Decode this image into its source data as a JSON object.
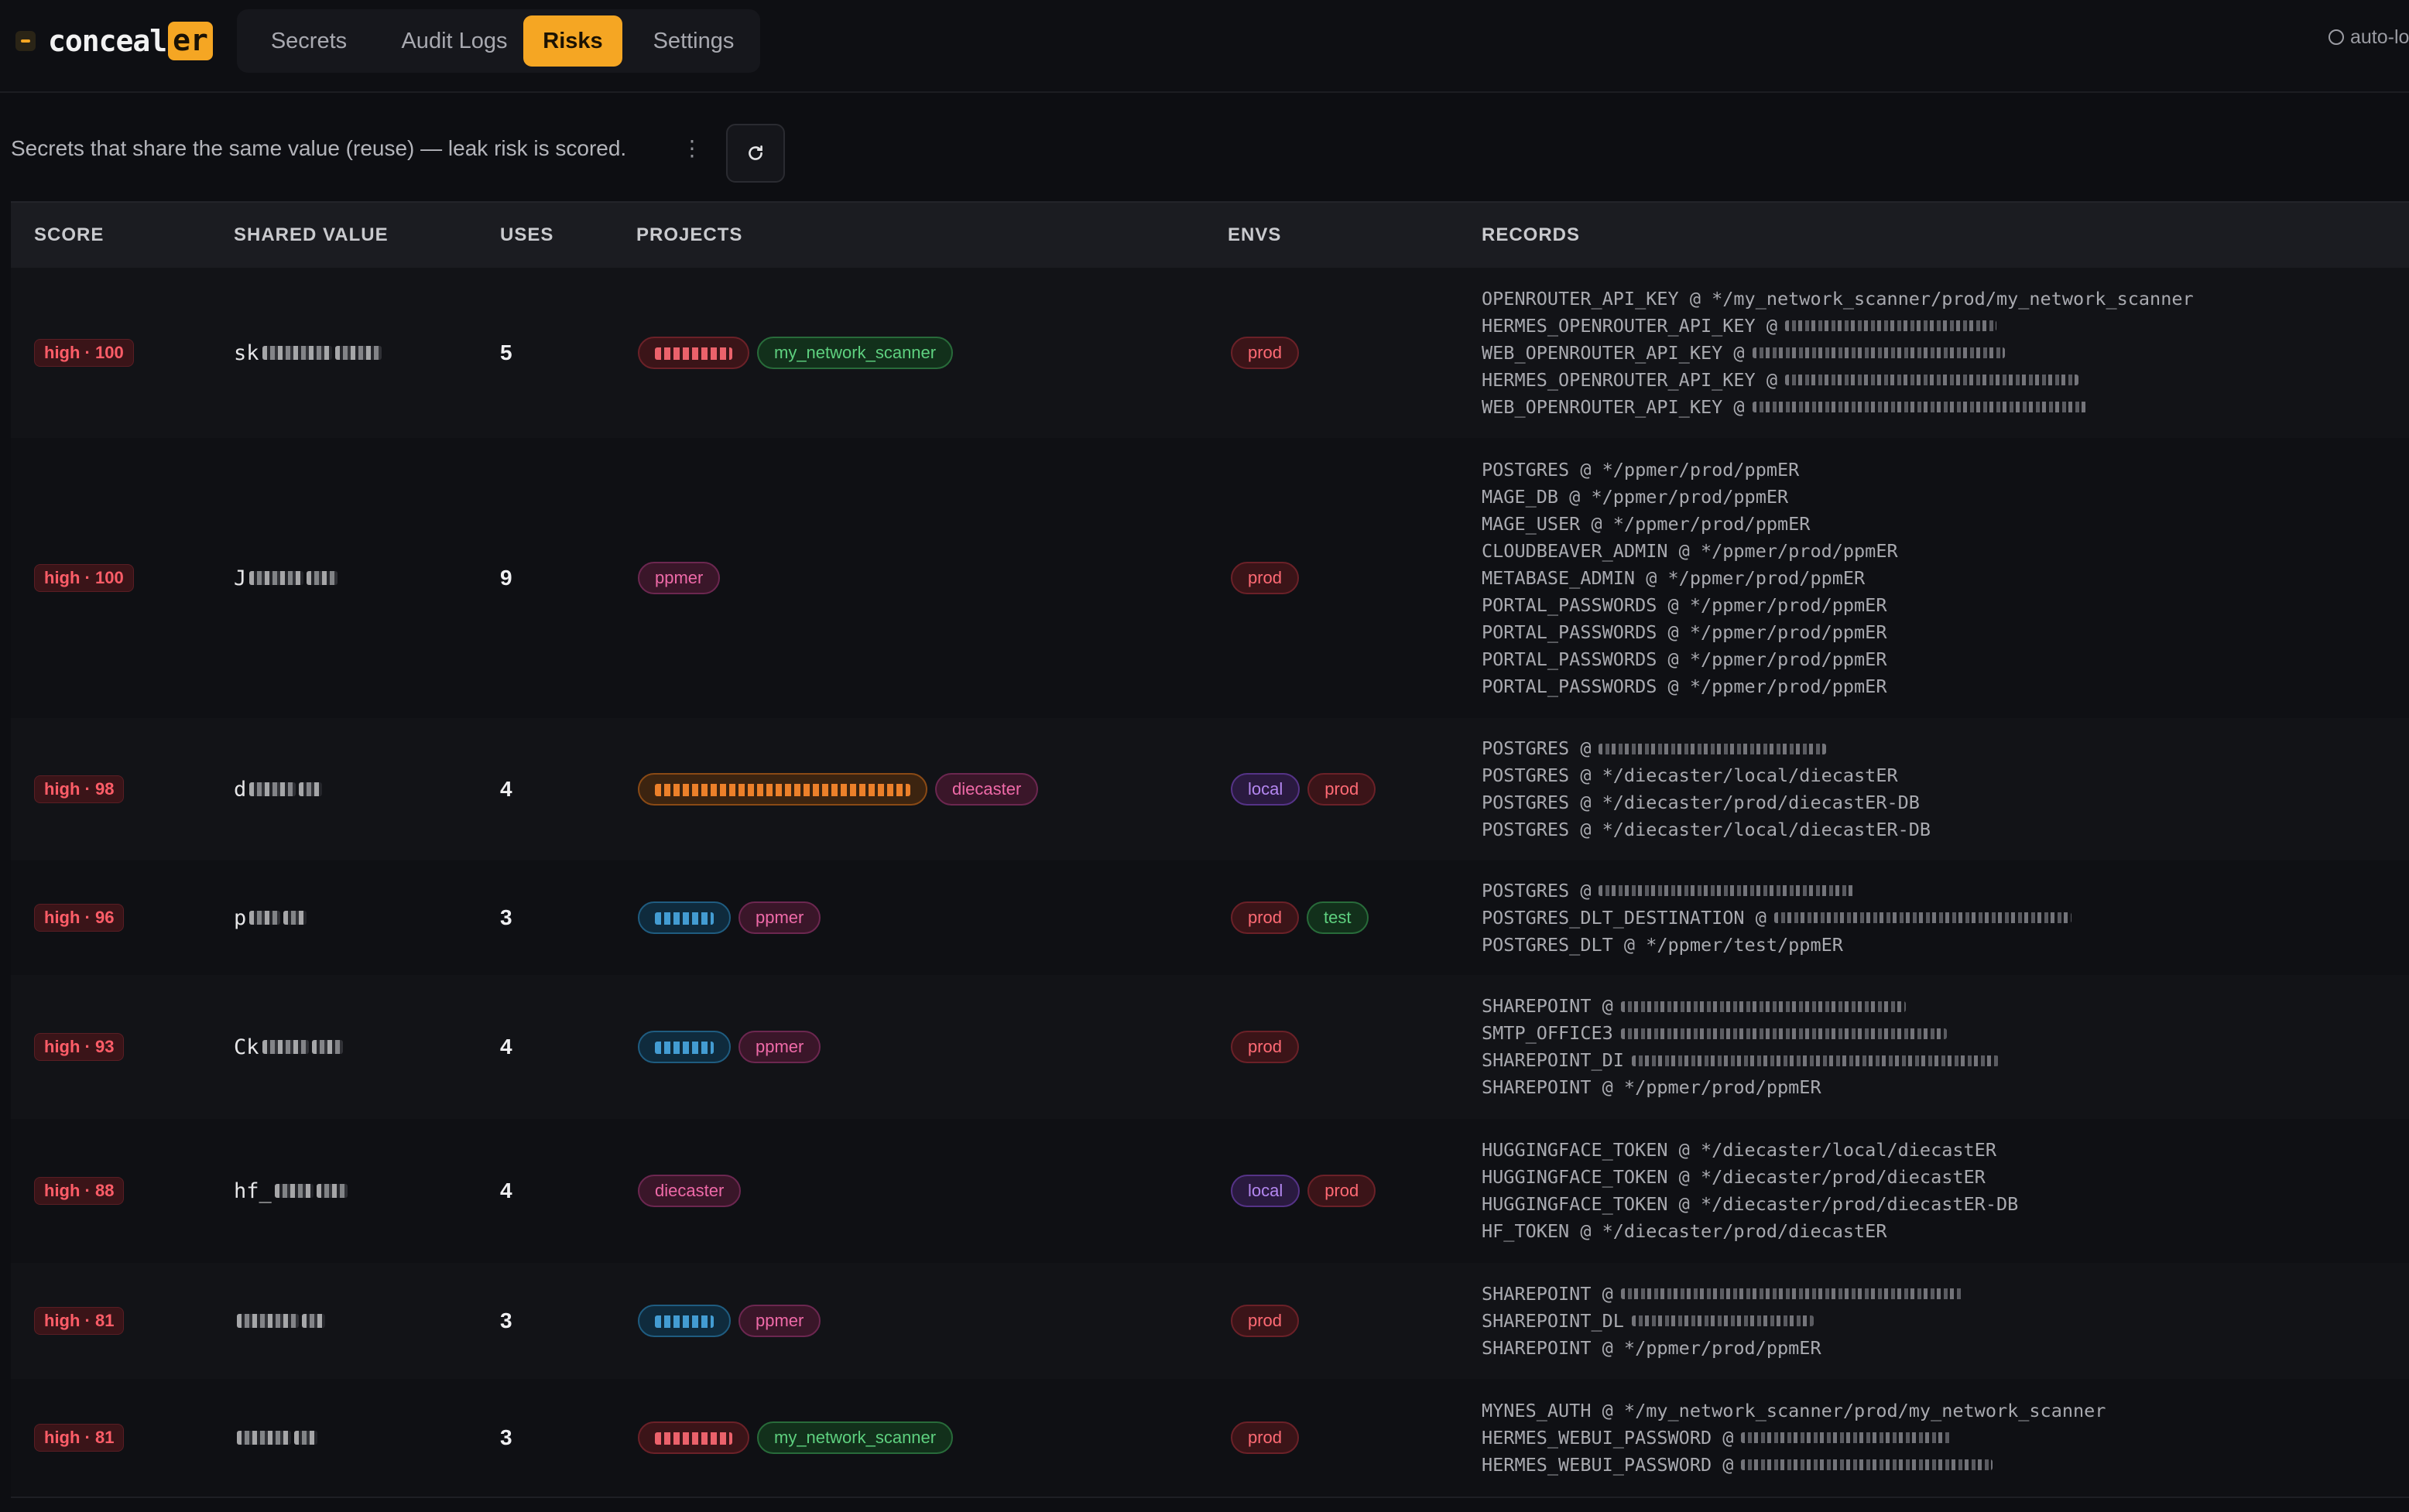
{
  "app": {
    "logo_text": "conceal",
    "logo_highlight": "er",
    "logo_icon": "app-logo-icon",
    "nav": [
      {
        "label": "Secrets"
      },
      {
        "label": "Audit Logs"
      },
      {
        "label": "Risks",
        "active": true
      },
      {
        "label": "Settings"
      }
    ],
    "autolock_label": "auto-lo",
    "accent": "#f5a623"
  },
  "page": {
    "description": "Secrets that share the same value (reuse) — leak risk is scored.",
    "menu_glyph": "⋮",
    "refresh_icon": "refresh-icon"
  },
  "table": {
    "headers": [
      "SCORE",
      "SHARED VALUE",
      "USES",
      "PROJECTS",
      "ENVS",
      "RECORDS"
    ],
    "rows": [
      {
        "score": "high · 100",
        "value_prefix": "sk",
        "uses": "5",
        "projects": [
          {
            "label": "",
            "color": "red",
            "masked": true
          },
          {
            "label": "my_network_scanner",
            "color": "green"
          }
        ],
        "envs": [
          {
            "label": "prod",
            "color": "red"
          }
        ],
        "records": [
          {
            "text": "OPENROUTER_API_KEY @ */my_network_scanner/prod/my_network_scanner"
          },
          {
            "text": "HERMES_OPENROUTER_API_KEY @",
            "masked": true
          },
          {
            "text": "WEB_OPENROUTER_API_KEY @",
            "masked": true
          },
          {
            "text": "HERMES_OPENROUTER_API_KEY @",
            "masked": true
          },
          {
            "text": "WEB_OPENROUTER_API_KEY @",
            "masked": true
          }
        ]
      },
      {
        "score": "high · 100",
        "value_prefix": "J",
        "uses": "9",
        "projects": [
          {
            "label": "ppmer",
            "color": "pink"
          }
        ],
        "envs": [
          {
            "label": "prod",
            "color": "red"
          }
        ],
        "records": [
          {
            "text": "POSTGRES @ */ppmer/prod/ppmER"
          },
          {
            "text": "MAGE_DB @ */ppmer/prod/ppmER"
          },
          {
            "text": "MAGE_USER @ */ppmer/prod/ppmER"
          },
          {
            "text": "CLOUDBEAVER_ADMIN @ */ppmer/prod/ppmER"
          },
          {
            "text": "METABASE_ADMIN @ */ppmer/prod/ppmER"
          },
          {
            "text": "PORTAL_PASSWORDS @ */ppmer/prod/ppmER"
          },
          {
            "text": "PORTAL_PASSWORDS @ */ppmer/prod/ppmER"
          },
          {
            "text": "PORTAL_PASSWORDS @ */ppmer/prod/ppmER"
          },
          {
            "text": "PORTAL_PASSWORDS @ */ppmer/prod/ppmER"
          }
        ]
      },
      {
        "score": "high · 98",
        "value_prefix": "d",
        "uses": "4",
        "projects": [
          {
            "label": "",
            "color": "orange",
            "masked": true
          },
          {
            "label": "diecaster",
            "color": "pink"
          }
        ],
        "envs": [
          {
            "label": "local",
            "color": "purple"
          },
          {
            "label": "prod",
            "color": "red"
          }
        ],
        "records": [
          {
            "text": "POSTGRES @",
            "masked": true
          },
          {
            "text": "POSTGRES @ */diecaster/local/diecastER"
          },
          {
            "text": "POSTGRES @ */diecaster/prod/diecastER-DB"
          },
          {
            "text": "POSTGRES @ */diecaster/local/diecastER-DB"
          }
        ]
      },
      {
        "score": "high · 96",
        "value_prefix": "p",
        "uses": "3",
        "projects": [
          {
            "label": "",
            "color": "blue",
            "masked": true
          },
          {
            "label": "ppmer",
            "color": "pink"
          }
        ],
        "envs": [
          {
            "label": "prod",
            "color": "red"
          },
          {
            "label": "test",
            "color": "green"
          }
        ],
        "records": [
          {
            "text": "POSTGRES @",
            "masked": true
          },
          {
            "text": "POSTGRES_DLT_DESTINATION @",
            "masked": true
          },
          {
            "text": "POSTGRES_DLT @ */ppmer/test/ppmER"
          }
        ]
      },
      {
        "score": "high · 93",
        "value_prefix": "Ck",
        "uses": "4",
        "projects": [
          {
            "label": "",
            "color": "blue",
            "masked": true
          },
          {
            "label": "ppmer",
            "color": "pink"
          }
        ],
        "envs": [
          {
            "label": "prod",
            "color": "red"
          }
        ],
        "records": [
          {
            "text": "SHAREPOINT @",
            "masked": true
          },
          {
            "text": "SMTP_OFFICE3",
            "masked": true
          },
          {
            "text": "SHAREPOINT_DI",
            "masked": true
          },
          {
            "text": "SHAREPOINT @ */ppmer/prod/ppmER"
          }
        ]
      },
      {
        "score": "high · 88",
        "value_prefix": "hf_",
        "uses": "4",
        "projects": [
          {
            "label": "diecaster",
            "color": "pink"
          }
        ],
        "envs": [
          {
            "label": "local",
            "color": "purple"
          },
          {
            "label": "prod",
            "color": "red"
          }
        ],
        "records": [
          {
            "text": "HUGGINGFACE_TOKEN @ */diecaster/local/diecastER"
          },
          {
            "text": "HUGGINGFACE_TOKEN @ */diecaster/prod/diecastER"
          },
          {
            "text": "HUGGINGFACE_TOKEN @ */diecaster/prod/diecastER-DB"
          },
          {
            "text": "HF_TOKEN @ */diecaster/prod/diecastER"
          }
        ]
      },
      {
        "score": "high · 81",
        "value_prefix": "",
        "uses": "3",
        "projects": [
          {
            "label": "",
            "color": "blue",
            "masked": true
          },
          {
            "label": "ppmer",
            "color": "pink"
          }
        ],
        "envs": [
          {
            "label": "prod",
            "color": "red"
          }
        ],
        "records": [
          {
            "text": "SHAREPOINT @",
            "masked": true
          },
          {
            "text": "SHAREPOINT_DL",
            "masked": true
          },
          {
            "text": "SHAREPOINT @ */ppmer/prod/ppmER"
          }
        ]
      },
      {
        "score": "high · 81",
        "value_prefix": "",
        "uses": "3",
        "projects": [
          {
            "label": "",
            "color": "red",
            "masked": true
          },
          {
            "label": "my_network_scanner",
            "color": "green"
          }
        ],
        "envs": [
          {
            "label": "prod",
            "color": "red"
          }
        ],
        "records": [
          {
            "text": "MYNES_AUTH @ */my_network_scanner/prod/my_network_scanner"
          },
          {
            "text": "HERMES_WEBUI_PASSWORD @",
            "masked": true
          },
          {
            "text": "HERMES_WEBUI_PASSWORD @",
            "masked": true
          }
        ]
      }
    ]
  }
}
